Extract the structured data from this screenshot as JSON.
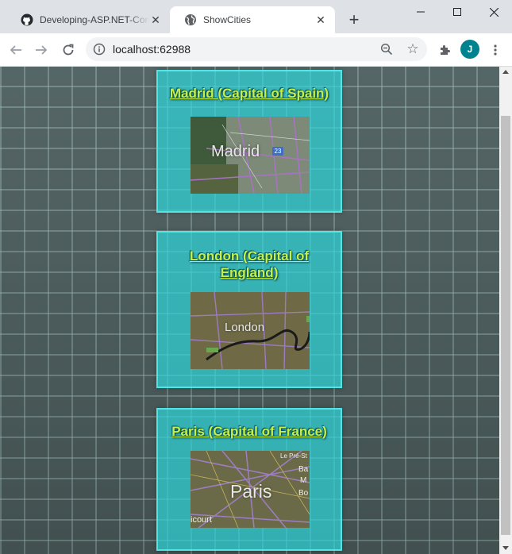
{
  "browser": {
    "tabs": [
      {
        "title": "Developing-ASP.NET-Core-",
        "icon": "github-icon",
        "active": false
      },
      {
        "title": "ShowCities",
        "icon": "globe-icon",
        "active": true
      }
    ],
    "address": "localhost:62988",
    "profile_initial": "J"
  },
  "cities": [
    {
      "title": "Madrid (Capital of Spain)",
      "map_label": "Madrid",
      "badge": "23"
    },
    {
      "title": "London (Capital of England)",
      "map_label": "London"
    },
    {
      "title": "Paris (Capital of France)",
      "map_label": "Paris",
      "map_edge_text": [
        "Le Pré-St",
        "Ba",
        "M",
        "Bo"
      ],
      "map_corner_text": "icourt"
    }
  ],
  "colors": {
    "card": "#2dd7dc",
    "title": "#c5f04a",
    "accent": "#00838f"
  }
}
